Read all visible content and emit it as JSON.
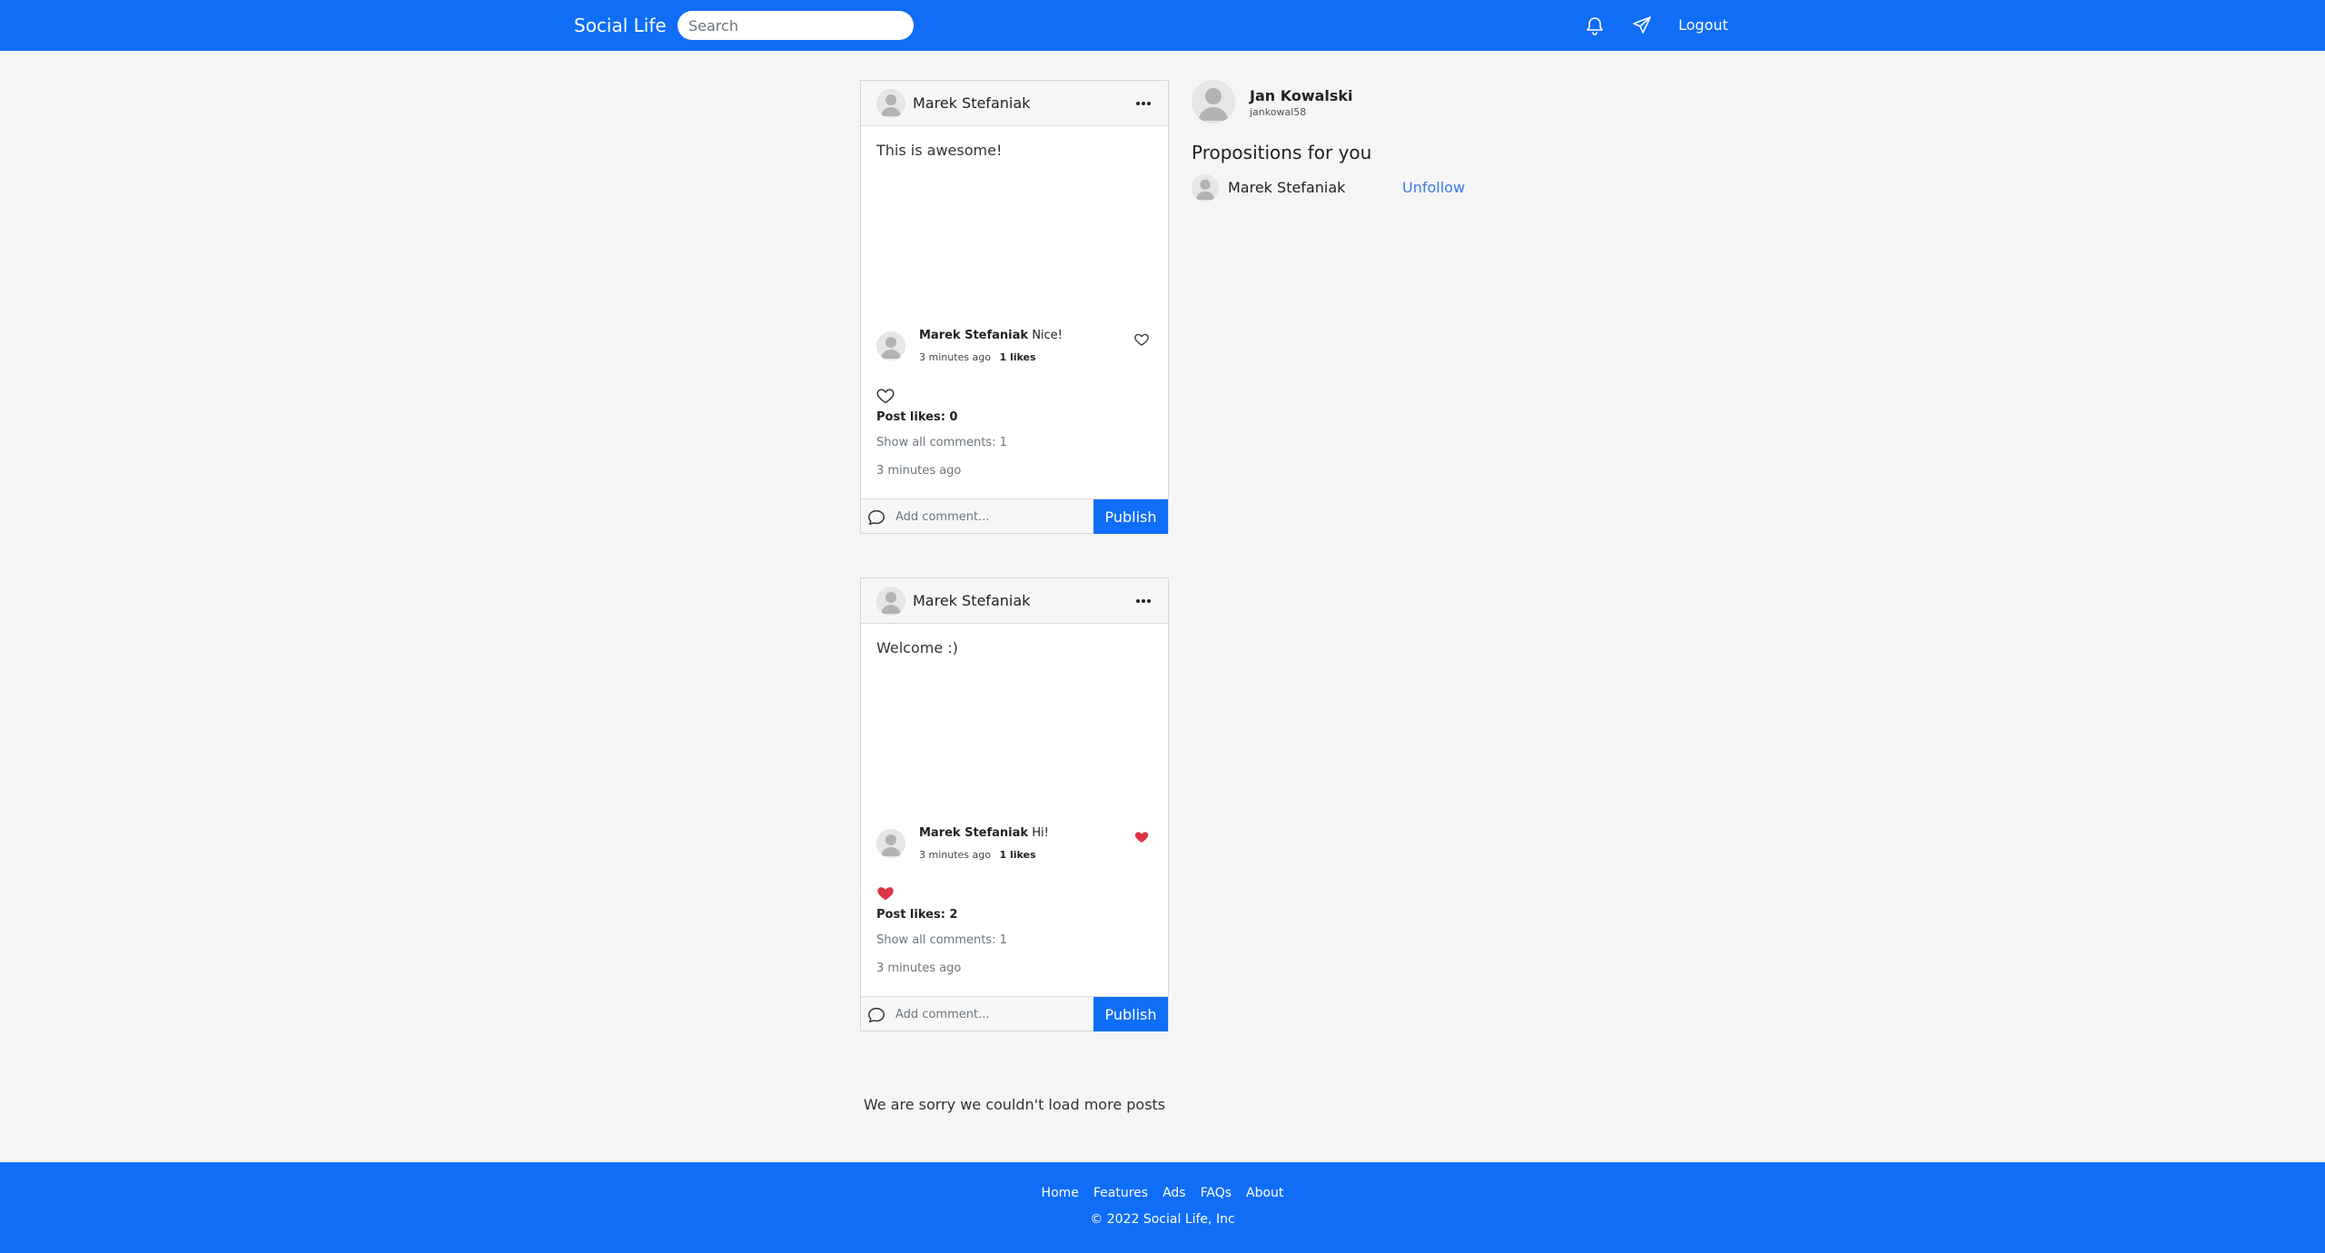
{
  "app": {
    "brand": "Social Life"
  },
  "search": {
    "placeholder": "Search"
  },
  "nav": {
    "logout": "Logout"
  },
  "posts": [
    {
      "author": "Marek Stefaniak",
      "text": "This is awesome!",
      "comment": {
        "author": "Marek Stefaniak",
        "text": "Nice!",
        "time": "3 minutes ago",
        "likes": "1 likes",
        "liked": false
      },
      "liked": false,
      "likes_label": "Post likes: 0",
      "show_comments": "Show all comments: 1",
      "time": "3 minutes ago",
      "comment_placeholder": "Add comment...",
      "publish": "Publish"
    },
    {
      "author": "Marek Stefaniak",
      "text": "Welcome :)",
      "comment": {
        "author": "Marek Stefaniak",
        "text": "Hi!",
        "time": "3 minutes ago",
        "likes": "1 likes",
        "liked": true
      },
      "liked": true,
      "likes_label": "Post likes: 2",
      "show_comments": "Show all comments: 1",
      "time": "3 minutes ago",
      "comment_placeholder": "Add comment...",
      "publish": "Publish"
    }
  ],
  "profile": {
    "name": "Jan Kowalski",
    "handle": "jankowal58"
  },
  "propositions": {
    "title": "Propositions for you",
    "items": [
      {
        "name": "Marek Stefaniak",
        "action": "Unfollow"
      }
    ]
  },
  "end_message": "We are sorry we couldn't load more posts",
  "footer": {
    "links": [
      "Home",
      "Features",
      "Ads",
      "FAQs",
      "About"
    ],
    "copyright": "© 2022 Social Life, Inc"
  },
  "colors": {
    "primary": "#0f6df7",
    "heart_liked": "#dc3545",
    "link": "#3a7be8"
  }
}
